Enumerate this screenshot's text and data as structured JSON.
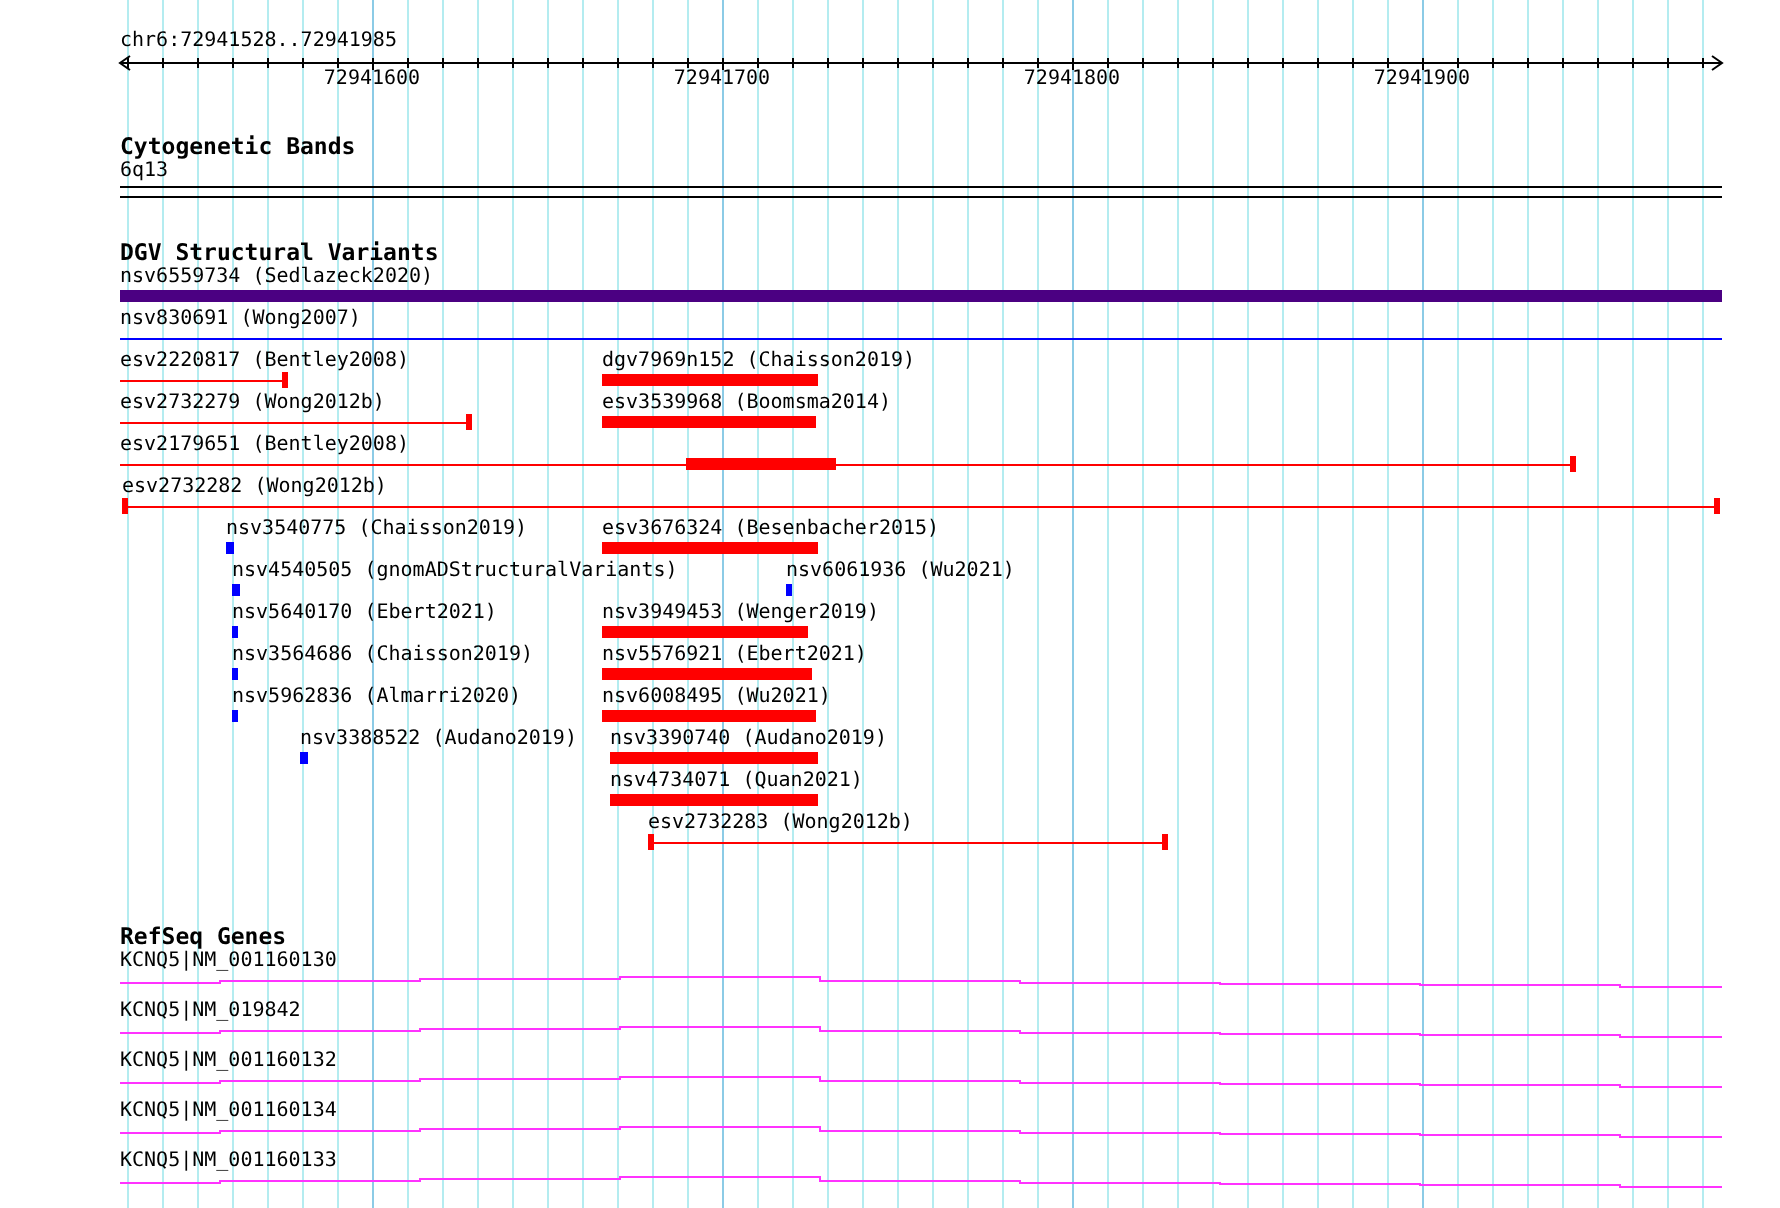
{
  "view": {
    "locus": "chr6:72941528..72941985"
  },
  "ruler": {
    "ticks": [
      {
        "label": "72941600"
      },
      {
        "label": "72941700"
      },
      {
        "label": "72941800"
      },
      {
        "label": "72941900"
      }
    ]
  },
  "cytogenetic_bands": {
    "title": "Cytogenetic Bands",
    "band": "6q13"
  },
  "dgv_structural_variants": {
    "title": "DGV Structural Variants",
    "rows": [
      {
        "features": [
          {
            "label": "nsv6559734 (Sedlazeck2020)",
            "kind": "block",
            "color": "#4b0082"
          }
        ]
      },
      {
        "features": [
          {
            "label": "nsv830691 (Wong2007)",
            "kind": "line",
            "color": "#0000ff"
          }
        ]
      },
      {
        "features": [
          {
            "label": "esv2220817 (Bentley2008)",
            "kind": "line",
            "color": "#ff0000"
          },
          {
            "label": "dgv7969n152 (Chaisson2019)",
            "kind": "block",
            "color": "#ff0000"
          }
        ]
      },
      {
        "features": [
          {
            "label": "esv2732279 (Wong2012b)",
            "kind": "line",
            "color": "#ff0000"
          },
          {
            "label": "esv3539968 (Boomsma2014)",
            "kind": "block",
            "color": "#ff0000"
          }
        ]
      },
      {
        "features": [
          {
            "label": "esv2179651 (Bentley2008)",
            "kind": "line_with_block",
            "color": "#ff0000"
          }
        ]
      },
      {
        "features": [
          {
            "label": "esv2732282 (Wong2012b)",
            "kind": "line",
            "color": "#ff0000"
          }
        ]
      },
      {
        "features": [
          {
            "label": "nsv3540775 (Chaisson2019)",
            "kind": "block",
            "color": "#0000ff"
          },
          {
            "label": "esv3676324 (Besenbacher2015)",
            "kind": "block",
            "color": "#ff0000"
          }
        ]
      },
      {
        "features": [
          {
            "label": "nsv4540505 (gnomADStructuralVariants)",
            "kind": "block",
            "color": "#0000ff"
          },
          {
            "label": "nsv6061936 (Wu2021)",
            "kind": "block",
            "color": "#0000ff"
          }
        ]
      },
      {
        "features": [
          {
            "label": "nsv5640170 (Ebert2021)",
            "kind": "block",
            "color": "#0000ff"
          },
          {
            "label": "nsv3949453 (Wenger2019)",
            "kind": "block",
            "color": "#ff0000"
          }
        ]
      },
      {
        "features": [
          {
            "label": "nsv3564686 (Chaisson2019)",
            "kind": "block",
            "color": "#0000ff"
          },
          {
            "label": "nsv5576921 (Ebert2021)",
            "kind": "block",
            "color": "#ff0000"
          }
        ]
      },
      {
        "features": [
          {
            "label": "nsv5962836 (Almarri2020)",
            "kind": "block",
            "color": "#0000ff"
          },
          {
            "label": "nsv6008495 (Wu2021)",
            "kind": "block",
            "color": "#ff0000"
          }
        ]
      },
      {
        "features": [
          {
            "label": "nsv3388522 (Audano2019)",
            "kind": "block",
            "color": "#0000ff"
          },
          {
            "label": "nsv3390740 (Audano2019)",
            "kind": "block",
            "color": "#ff0000"
          }
        ]
      },
      {
        "features": [
          {
            "label": "nsv4734071 (Quan2021)",
            "kind": "block",
            "color": "#ff0000"
          }
        ]
      },
      {
        "features": [
          {
            "label": "esv2732283 (Wong2012b)",
            "kind": "line",
            "color": "#ff0000"
          }
        ]
      }
    ]
  },
  "refseq_genes": {
    "title": "RefSeq Genes",
    "genes": [
      {
        "label": "KCNQ5|NM_001160130"
      },
      {
        "label": "KCNQ5|NM_019842"
      },
      {
        "label": "KCNQ5|NM_001160132"
      },
      {
        "label": "KCNQ5|NM_001160134"
      },
      {
        "label": "KCNQ5|NM_001160133"
      }
    ]
  }
}
